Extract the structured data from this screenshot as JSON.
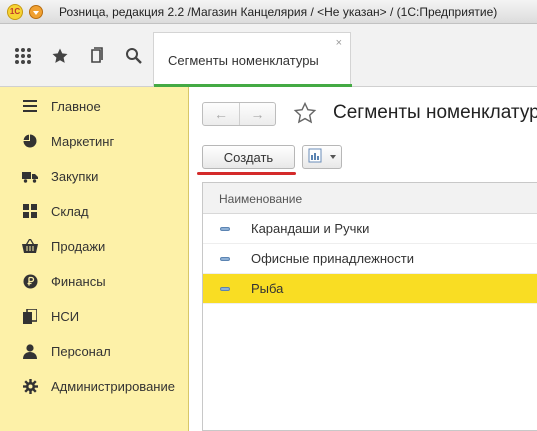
{
  "window": {
    "title": "Розница, редакция 2.2 /Магазин Канцелярия / <Не указан> /  (1С:Предприятие)",
    "logo_text": "1С"
  },
  "toolbar": {
    "icons": [
      "apps-grid-icon",
      "star-icon",
      "history-icon",
      "search-icon"
    ]
  },
  "tabs": [
    {
      "label": "Сегменты номенклатуры",
      "active": true,
      "close": "×"
    }
  ],
  "sidebar": {
    "items": [
      {
        "label": "Главное",
        "icon": "menu-lines-icon"
      },
      {
        "label": "Маркетинг",
        "icon": "pie-chart-icon"
      },
      {
        "label": "Закупки",
        "icon": "truck-icon"
      },
      {
        "label": "Склад",
        "icon": "warehouse-grid-icon"
      },
      {
        "label": "Продажи",
        "icon": "basket-icon"
      },
      {
        "label": "Финансы",
        "icon": "ruble-icon"
      },
      {
        "label": "НСИ",
        "icon": "documents-icon"
      },
      {
        "label": "Персонал",
        "icon": "person-icon"
      },
      {
        "label": "Администрирование",
        "icon": "gear-icon"
      }
    ]
  },
  "main": {
    "back": "←",
    "forward": "→",
    "title": "Сегменты номенклатуры",
    "create_label": "Создать",
    "table": {
      "column_header": "Наименование",
      "rows": [
        {
          "label": "Карандаши и Ручки",
          "selected": false
        },
        {
          "label": "Офисные принадлежности",
          "selected": false
        },
        {
          "label": "Рыба",
          "selected": true
        }
      ]
    }
  },
  "colors": {
    "sidebar_bg": "#fdf1a8",
    "selected_row": "#f9dd23",
    "active_tab_underline": "#44aa44",
    "annotation_red": "#d42a2a"
  }
}
